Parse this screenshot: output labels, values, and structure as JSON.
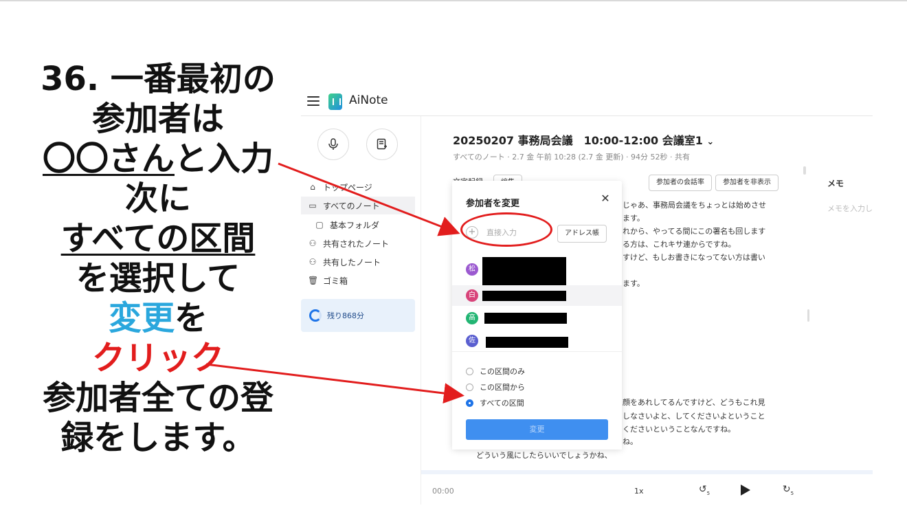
{
  "slide": {
    "l1": "36. 一番最初の",
    "l2": "参加者は",
    "l3_u": "〇〇さん",
    "l3_rest": "と入力",
    "l4": "次に",
    "l5_u": "すべての区間",
    "l6": "を選択して",
    "l7_blue": "変更",
    "l7_rest": "を",
    "l8_red": "クリック",
    "l9": "参加者全ての登",
    "l10": "録をします。"
  },
  "app": {
    "title": "AiNote"
  },
  "sidebar": {
    "items": [
      {
        "label": "トップページ",
        "icon": "home-icon"
      },
      {
        "label": "すべてのノート",
        "icon": "inbox-icon"
      },
      {
        "label": "基本フォルダ",
        "icon": "folder-icon"
      },
      {
        "label": "共有されたノート",
        "icon": "shared-with-me-icon"
      },
      {
        "label": "共有したノート",
        "icon": "shared-by-me-icon"
      },
      {
        "label": "ゴミ箱",
        "icon": "trash-icon"
      }
    ],
    "remaining": "残り868分"
  },
  "note": {
    "title": "20250207 事務局会議　10:00-12:00 会議室1",
    "meta": "すべてのノート · 2.7 金 午前 10:28 (2.7 金 更新) · 94分 52秒 · 共有",
    "transcript_label": "文字起録",
    "edit_chip": "編集",
    "speaker_rate": "参加者の会話率",
    "hide_speakers": "参加者を非表示",
    "memo_label": "メモ",
    "memo_placeholder": "メモを入力し",
    "lines": [
      "じゃあ、事務局会議をちょっとは始めさせ",
      "ます。",
      "れから、やってる間にこの署名も回します",
      "る方は、これキサ連からですね。",
      "すけど、もしお書きになってない方は書い",
      "ます。",
      "顔をあれしてるんですけど、どうもこれ見",
      "しなさいよと、してくださいよということ",
      "くださいということなんですね。",
      "ね。",
      "どういう風にしたらいいでしょうかね、"
    ]
  },
  "player": {
    "time": "00:00",
    "speed": "1x",
    "back_label": "5",
    "fwd_label": "5"
  },
  "dialog": {
    "title": "参加者を変更",
    "input_placeholder": "直接入力",
    "address_book": "アドレス帳",
    "participants": [
      {
        "initial": "松",
        "color": "#9b59d0"
      },
      {
        "initial": "白",
        "color": "#d8447a"
      },
      {
        "initial": "高",
        "color": "#22b573"
      },
      {
        "initial": "佐",
        "color": "#5a5fd0"
      }
    ],
    "options": [
      "この区間のみ",
      "この区間から",
      "すべての区間"
    ],
    "selected_option": "すべての区間",
    "change_button": "変更"
  }
}
